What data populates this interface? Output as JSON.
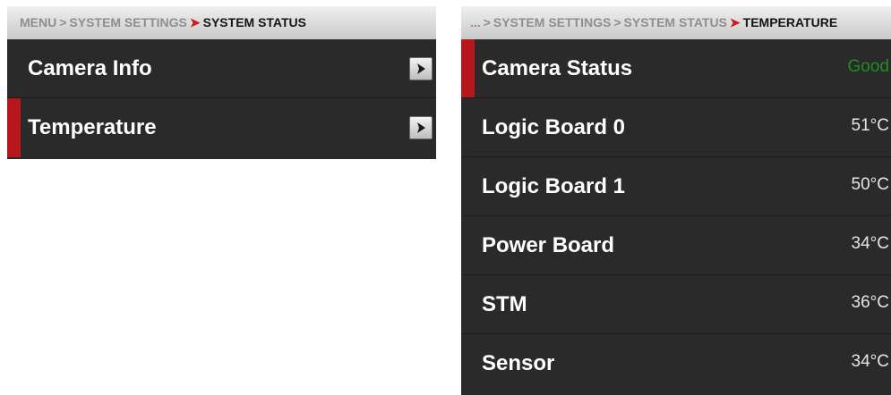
{
  "left": {
    "breadcrumb": {
      "part1": "MENU",
      "part2": "SYSTEM SETTINGS",
      "current": "SYSTEM STATUS"
    },
    "rows": [
      {
        "label": "Camera Info"
      },
      {
        "label": "Temperature"
      }
    ]
  },
  "right": {
    "breadcrumb": {
      "part1": "...",
      "part2": "SYSTEM SETTINGS",
      "part3": "SYSTEM STATUS",
      "current": "TEMPERATURE"
    },
    "rows": [
      {
        "label": "Camera Status",
        "value": "Good"
      },
      {
        "label": "Logic Board 0",
        "value": "51°C"
      },
      {
        "label": "Logic Board 1",
        "value": "50°C"
      },
      {
        "label": "Power Board",
        "value": "34°C"
      },
      {
        "label": "STM",
        "value": "36°C"
      },
      {
        "label": "Sensor",
        "value": "34°C"
      }
    ]
  },
  "colors": {
    "accent_red": "#b5171d",
    "status_good": "#1f8f1f",
    "panel_bg": "#2a2a2a"
  },
  "icons": {
    "row_arrow": "chevron-right-icon"
  }
}
